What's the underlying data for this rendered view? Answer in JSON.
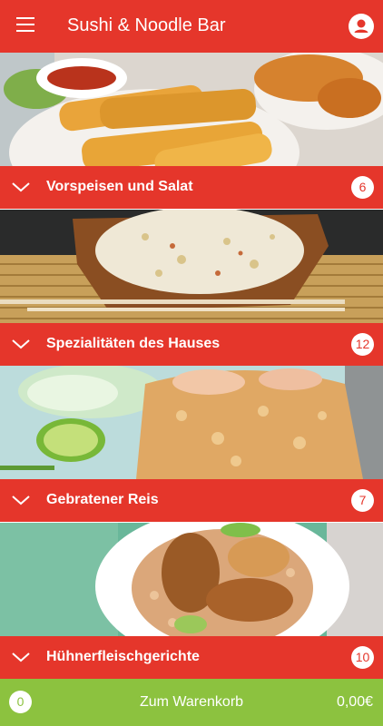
{
  "app": {
    "title": "Sushi & Noodle Bar"
  },
  "icons": {
    "menu": "menu-icon",
    "account": "account-icon",
    "chevron": "chevron-down-icon"
  },
  "colors": {
    "primary": "#e5362b",
    "cart": "#8cc23f"
  },
  "categories": [
    {
      "label": "Vorspeisen und Salat",
      "count": "6",
      "image": "spring-rolls-photo"
    },
    {
      "label": "Spezialitäten des Hauses",
      "count": "12",
      "image": "fried-rice-bowl-photo"
    },
    {
      "label": "Gebratener Reis",
      "count": "7",
      "image": "shrimp-fried-rice-photo"
    },
    {
      "label": "Hühnerfleischgerichte",
      "count": "10",
      "image": "chicken-rice-photo"
    }
  ],
  "cart": {
    "count": "0",
    "label": "Zum Warenkorb",
    "total": "0,00€"
  }
}
